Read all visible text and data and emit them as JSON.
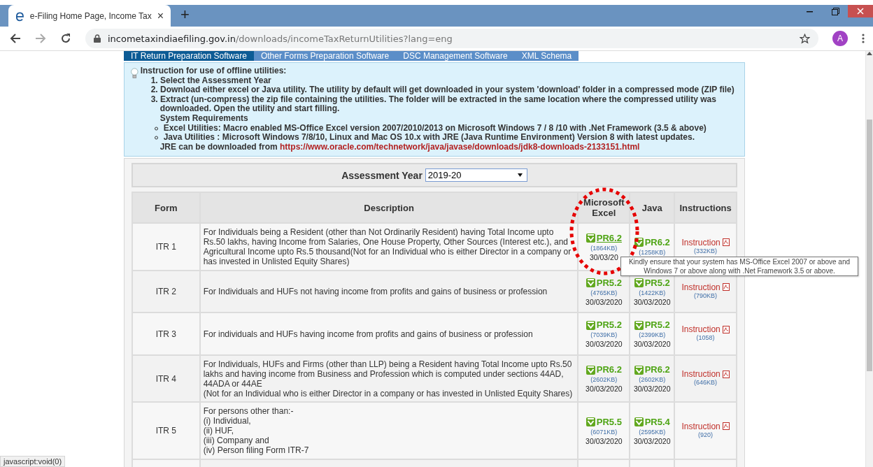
{
  "browser": {
    "tab": {
      "title": "e-Filing Home Page, Income Tax",
      "close": "×"
    },
    "new_tab": "+",
    "url": {
      "host": "incometaxindiaefiling.gov.in",
      "path": "/downloads/incomeTaxReturnUtilities?lang=eng"
    },
    "profile": "A"
  },
  "tabs": [
    {
      "label": "IT Return Preparation Software",
      "selected": true
    },
    {
      "label": "Other Forms Preparation Software",
      "selected": false
    },
    {
      "label": "DSC Management Software",
      "selected": false
    },
    {
      "label": "XML Schema",
      "selected": false
    }
  ],
  "instructions": {
    "title": "Instruction for use of offline utilities:",
    "steps": [
      "1. Select the Assessment Year",
      "2. Download either excel or Java utility. The utility by default will get downloaded in your system 'download' folder in a compressed mode (ZIP file)",
      "3. Extract (un-compress) the zip file containing the utilities. The folder will be extracted in the same location where the compressed utility was downloaded. Open the utility and start filling."
    ],
    "requirements_title": "System Requirements",
    "requirements": [
      "Excel Utilities:  Macro enabled MS-Office Excel version 2007/2010/2013 on Microsoft Windows 7 / 8 /10 with .Net Framework (3.5 & above)",
      "Java Utilities :  Microsoft Windows 7/8/10, Linux and Mac OS 10.x with JRE (Java Runtime Environment) Version 8 with latest updates."
    ],
    "jre_text": "JRE can be downloaded from",
    "jre_link": "https://www.oracle.com/technetwork/java/javase/downloads/jdk8-downloads-2133151.html"
  },
  "assessment": {
    "label": "Assessment Year",
    "value": "2019-20"
  },
  "table": {
    "columns": [
      "Form",
      "Description",
      "Microsoft Excel",
      "Java",
      "Instructions"
    ],
    "rows": [
      {
        "form": "ITR 1",
        "description": [
          "For Individuals being a Resident (other than Not Ordinarily Resident) having Total Income upto Rs.50 lakhs, having Income from Salaries, One House Property, Other Sources (Interest etc.), and Agricultural Income upto Rs.5 thousand(Not for an Individual who is either Director in a company or has invested in Unlisted Equity Shares)"
        ],
        "excel": {
          "version": "PR6.2",
          "size": "(1864KB)",
          "date": "30/03/20",
          "hovered": true
        },
        "java": {
          "version": "PR6.2",
          "size": "(1258KB)",
          "hovered": false
        },
        "instruction": {
          "label": "Instruction",
          "size": "(332KB)"
        }
      },
      {
        "form": "ITR 2",
        "description": [
          "For Individuals and HUFs not having income from profits and gains of business or profession"
        ],
        "excel": {
          "version": "PR5.2",
          "size": "(4765KB)",
          "date": "30/03/2020",
          "hovered": false
        },
        "java": {
          "version": "PR5.2",
          "size": "(1422KB)",
          "date": "30/03/2020",
          "hovered": false
        },
        "instruction": {
          "label": "Instruction",
          "size": "(790KB)"
        }
      },
      {
        "form": "ITR 3",
        "description": [
          "For individuals and HUFs having income from profits and gains of business or profession"
        ],
        "excel": {
          "version": "PR5.2",
          "size": "(7039KB)",
          "date": "30/03/2020",
          "hovered": false
        },
        "java": {
          "version": "PR5.2",
          "size": "(2399KB)",
          "date": "30/03/2020",
          "hovered": false
        },
        "instruction": {
          "label": "Instruction",
          "size": "(1058)"
        }
      },
      {
        "form": "ITR 4",
        "description": [
          "For Individuals, HUFs and Firms (other than LLP) being a Resident having Total Income upto Rs.50 lakhs and having income from Business and Profession which is computed under sections 44AD, 44ADA or 44AE",
          "(Not for an Individual who is either Director in a company or has invested in Unlisted Equity Shares)"
        ],
        "excel": {
          "version": "PR6.2",
          "size": "(2602KB)",
          "date": "30/03/2020",
          "hovered": false
        },
        "java": {
          "version": "PR6.2",
          "size": "(2602KB)",
          "date": "30/03/2020",
          "hovered": false
        },
        "instruction": {
          "label": "Instruction",
          "size": "(646KB)"
        }
      },
      {
        "form": "ITR 5",
        "description": [
          "For persons other than:-",
          "(i) Individual,",
          "(ii) HUF,",
          "(iii) Company and",
          "(iv) Person filing Form ITR-7"
        ],
        "excel": {
          "version": "PR5.5",
          "size": "(6071KB)",
          "date": "30/03/2020",
          "hovered": false
        },
        "java": {
          "version": "PR5.4",
          "size": "(2595KB)",
          "date": "30/03/2020",
          "hovered": false
        },
        "instruction": {
          "label": "Instruction",
          "size": "(920)"
        }
      }
    ]
  },
  "tooltip": "Kindly ensure that your system has MS-Office Excel 2007 or  above and Windows 7 or above along with .Net Framework 3.5 or above.",
  "status_bar": "javascript:void(0)"
}
